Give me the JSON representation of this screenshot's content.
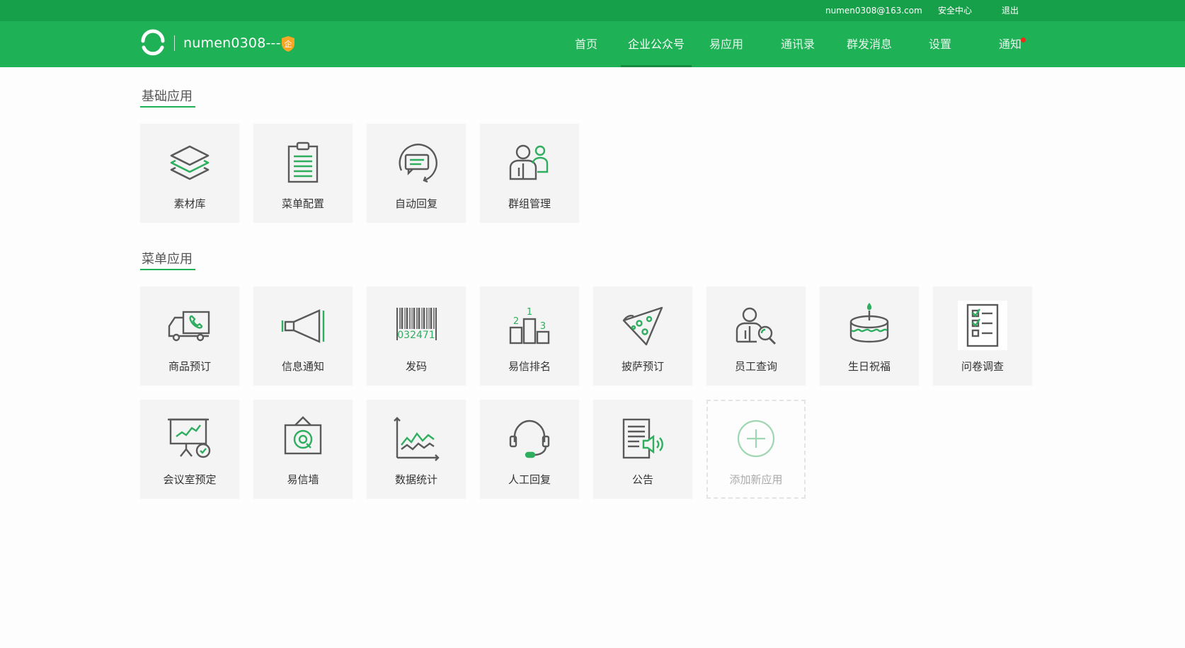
{
  "topbar": {
    "email": "numen0308@163.com",
    "security_center": "安全中心",
    "logout": "退出"
  },
  "header": {
    "account_name": "numen0308---",
    "badge_char": "企",
    "nav": [
      {
        "label": "首页",
        "active": false
      },
      {
        "label": "企业公众号",
        "active": true
      },
      {
        "label": "易应用",
        "active": false
      },
      {
        "label": "通讯录",
        "active": false
      },
      {
        "label": "群发消息",
        "active": false
      },
      {
        "label": "设置",
        "active": false
      },
      {
        "label": "通知",
        "active": false,
        "has_dot": true
      }
    ]
  },
  "sections": {
    "basic": {
      "title": "基础应用",
      "apps": [
        {
          "label": "素材库",
          "icon": "layers-icon"
        },
        {
          "label": "菜单配置",
          "icon": "clipboard-list-icon"
        },
        {
          "label": "自动回复",
          "icon": "auto-reply-icon"
        },
        {
          "label": "群组管理",
          "icon": "group-users-icon"
        }
      ]
    },
    "menu": {
      "title": "菜单应用",
      "apps": [
        {
          "label": "商品预订",
          "icon": "delivery-truck-icon"
        },
        {
          "label": "信息通知",
          "icon": "megaphone-icon"
        },
        {
          "label": "发码",
          "icon": "barcode-icon",
          "barcode_text": "032471"
        },
        {
          "label": "易信排名",
          "icon": "ranking-podium-icon",
          "ranks": [
            "1",
            "2",
            "3"
          ]
        },
        {
          "label": "披萨预订",
          "icon": "pizza-slice-icon"
        },
        {
          "label": "员工查询",
          "icon": "employee-search-icon"
        },
        {
          "label": "生日祝福",
          "icon": "birthday-cake-icon"
        },
        {
          "label": "问卷调查",
          "icon": "survey-checklist-icon"
        },
        {
          "label": "会议室预定",
          "icon": "presentation-board-icon"
        },
        {
          "label": "易信墙",
          "icon": "photo-wall-icon"
        },
        {
          "label": "数据统计",
          "icon": "line-chart-icon"
        },
        {
          "label": "人工回复",
          "icon": "headset-icon"
        },
        {
          "label": "公告",
          "icon": "announcement-icon"
        },
        {
          "label": "添加新应用",
          "icon": "add-circle-icon"
        }
      ]
    }
  },
  "colors": {
    "brand_green": "#1eb155",
    "topstrip_green": "#17a04a",
    "icon_gray": "#5a5a5a",
    "icon_green": "#2fae5f",
    "notice_red": "#f2291c",
    "badge_orange": "#f5a623"
  }
}
